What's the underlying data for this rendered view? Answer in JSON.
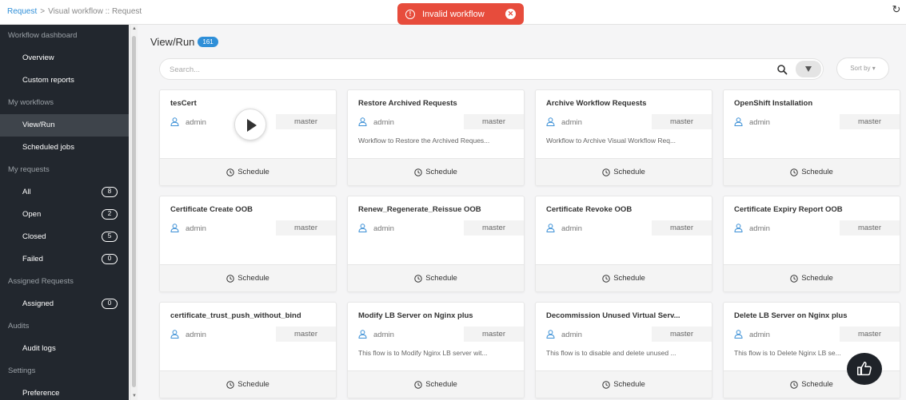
{
  "breadcrumb": {
    "link": "Request",
    "separator": ">",
    "current": "Visual workflow :: Request"
  },
  "toast": {
    "message": "Invalid workflow",
    "icon": "info-icon",
    "close_icon": "close-icon",
    "color": "#e74c3c"
  },
  "colors": {
    "accent": "#2f8fd8",
    "sidebar_bg": "#22272e",
    "sidebar_active": "#3e444b"
  },
  "sidebar": {
    "workflow_dashboard": {
      "label": "Workflow dashboard",
      "items": [
        {
          "label": "Overview"
        },
        {
          "label": "Custom reports"
        }
      ]
    },
    "my_workflows": {
      "label": "My workflows",
      "items": [
        {
          "label": "View/Run",
          "active": true
        },
        {
          "label": "Scheduled jobs"
        }
      ]
    },
    "my_requests": {
      "label": "My requests",
      "items": [
        {
          "label": "All",
          "count": "8"
        },
        {
          "label": "Open",
          "count": "2"
        },
        {
          "label": "Closed",
          "count": "5"
        },
        {
          "label": "Failed",
          "count": "0"
        }
      ]
    },
    "assigned_requests": {
      "label": "Assigned Requests",
      "items": [
        {
          "label": "Assigned",
          "count": "0"
        }
      ]
    },
    "audits": {
      "label": "Audits",
      "items": [
        {
          "label": "Audit logs"
        }
      ]
    },
    "settings": {
      "label": "Settings",
      "items": [
        {
          "label": "Preference"
        }
      ]
    }
  },
  "main": {
    "title": "View/Run",
    "count": "161"
  },
  "search": {
    "placeholder": "Search...",
    "value": ""
  },
  "sort": {
    "label": "Sort by ▾"
  },
  "cards": [
    {
      "title": "tesCert",
      "owner": "admin",
      "branch": "master",
      "description": "",
      "schedule_label": "Schedule",
      "has_play": true
    },
    {
      "title": "Restore Archived Requests",
      "owner": "admin",
      "branch": "master",
      "description": "Workflow to Restore the Archived Reques...",
      "schedule_label": "Schedule"
    },
    {
      "title": "Archive Workflow Requests",
      "owner": "admin",
      "branch": "master",
      "description": "Workflow to Archive Visual Workflow Req...",
      "schedule_label": "Schedule"
    },
    {
      "title": "OpenShift Installation",
      "owner": "admin",
      "branch": "master",
      "description": "",
      "schedule_label": "Schedule"
    },
    {
      "title": "Certificate Create OOB",
      "owner": "admin",
      "branch": "master",
      "description": "",
      "schedule_label": "Schedule"
    },
    {
      "title": "Renew_Regenerate_Reissue OOB",
      "owner": "admin",
      "branch": "master",
      "description": "",
      "schedule_label": "Schedule"
    },
    {
      "title": "Certificate Revoke OOB",
      "owner": "admin",
      "branch": "master",
      "description": "",
      "schedule_label": "Schedule"
    },
    {
      "title": "Certificate Expiry Report OOB",
      "owner": "admin",
      "branch": "master",
      "description": "",
      "schedule_label": "Schedule"
    },
    {
      "title": "certificate_trust_push_without_bind",
      "owner": "admin",
      "branch": "master",
      "description": "",
      "schedule_label": "Schedule"
    },
    {
      "title": "Modify LB Server on Nginx plus",
      "owner": "admin",
      "branch": "master",
      "description": "This flow is to Modify Nginx LB server wit...",
      "schedule_label": "Schedule"
    },
    {
      "title": "Decommission Unused Virtual Serv...",
      "owner": "admin",
      "branch": "master",
      "description": "This flow is to disable and delete unused ...",
      "schedule_label": "Schedule"
    },
    {
      "title": "Delete LB Server on Nginx plus",
      "owner": "admin",
      "branch": "master",
      "description": "This flow is to Delete Nginx LB se...",
      "schedule_label": "Schedule"
    }
  ],
  "fab": {
    "icon": "thumbs-up-icon"
  }
}
